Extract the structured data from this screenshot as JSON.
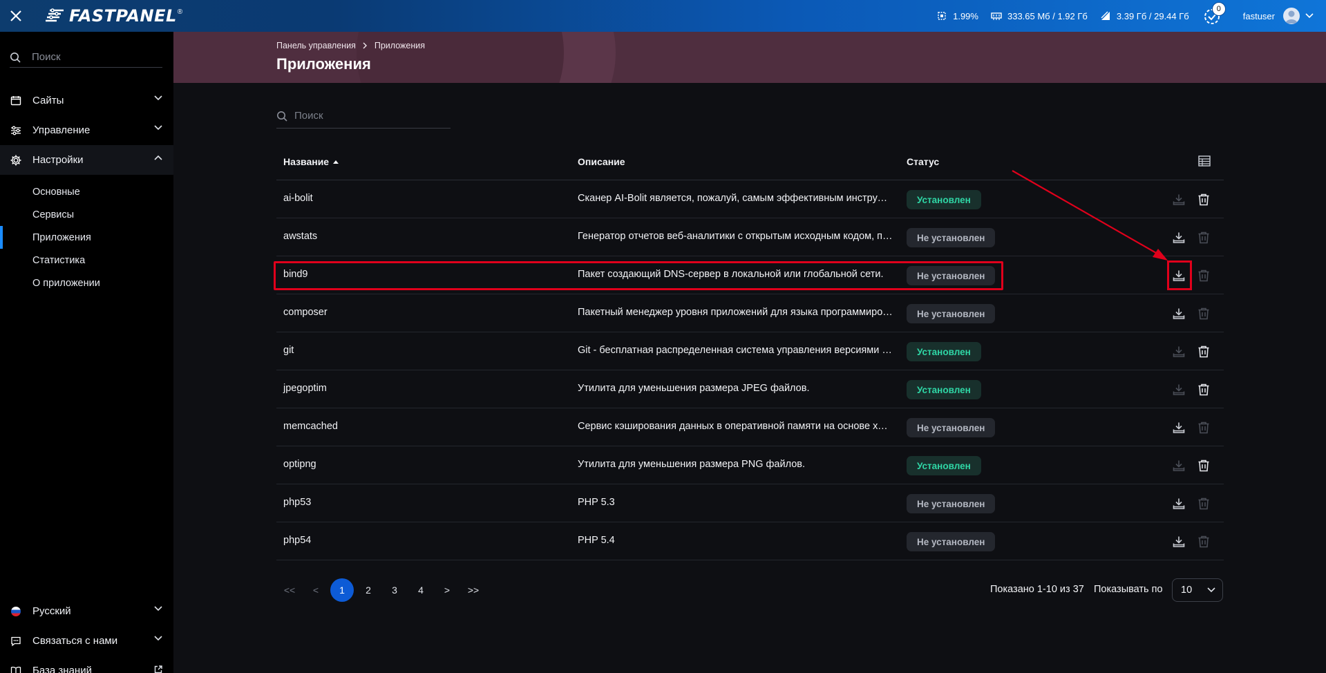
{
  "topbar": {
    "logo": "FASTPANEL",
    "logo_reg": "®",
    "cpu": "1.99%",
    "ram": "333.65 Мб / 1.92 Гб",
    "disk": "3.39 Гб / 29.44 Гб",
    "notifications": "0",
    "username": "fastuser"
  },
  "sidebar": {
    "search_placeholder": "Поиск",
    "items": [
      {
        "label": "Сайты"
      },
      {
        "label": "Управление"
      },
      {
        "label": "Настройки"
      }
    ],
    "sub_items": [
      {
        "label": "Основные"
      },
      {
        "label": "Сервисы"
      },
      {
        "label": "Приложения"
      },
      {
        "label": "Статистика"
      },
      {
        "label": "О приложении"
      }
    ],
    "bottom": [
      {
        "label": "Русский"
      },
      {
        "label": "Связаться с нами"
      },
      {
        "label": "База знаний"
      }
    ]
  },
  "header": {
    "breadcrumb_root": "Панель управления",
    "breadcrumb_current": "Приложения",
    "title": "Приложения"
  },
  "main": {
    "search_placeholder": "Поиск",
    "columns": {
      "name": "Название",
      "description": "Описание",
      "status": "Статус"
    },
    "rows": [
      {
        "name": "ai-bolit",
        "description": "Сканер AI-Bolit является, пожалуй, самым эффективным инструментом",
        "status": "Установлен",
        "installed": true
      },
      {
        "name": "awstats",
        "description": "Генератор отчетов веб-аналитики с открытым исходным кодом, предназначенный",
        "status": "Не установлен",
        "installed": false
      },
      {
        "name": "bind9",
        "description": "Пакет создающий DNS-сервер в локальной или глобальной сети.",
        "status": "Не установлен",
        "installed": false
      },
      {
        "name": "composer",
        "description": "Пакетный менеджер уровня приложений для языка программирования PHP",
        "status": "Не установлен",
        "installed": false
      },
      {
        "name": "git",
        "description": "Git - бесплатная распределенная система управления версиями с открытым",
        "status": "Установлен",
        "installed": true
      },
      {
        "name": "jpegoptim",
        "description": "Утилита для уменьшения размера JPEG файлов.",
        "status": "Установлен",
        "installed": true
      },
      {
        "name": "memcached",
        "description": "Сервис кэширования данных в оперативной памяти на основе хеш-таблицы",
        "status": "Не установлен",
        "installed": false
      },
      {
        "name": "optipng",
        "description": "Утилита для уменьшения размера PNG файлов.",
        "status": "Установлен",
        "installed": true
      },
      {
        "name": "php53",
        "description": "PHP 5.3",
        "status": "Не установлен",
        "installed": false
      },
      {
        "name": "php54",
        "description": "PHP 5.4",
        "status": "Не установлен",
        "installed": false
      }
    ],
    "pagination": {
      "first": "<<",
      "prev": "<",
      "pages": [
        "1",
        "2",
        "3",
        "4"
      ],
      "current": "1",
      "next": ">",
      "last": ">>"
    },
    "shown_text": "Показано 1-10 из 37",
    "per_page_label": "Показывать по",
    "per_page_value": "10"
  },
  "colors": {
    "accent": "#0d5bd6",
    "installed": "#2fd7a6",
    "highlight": "#e0001b",
    "banner": "#4f2e3f"
  }
}
